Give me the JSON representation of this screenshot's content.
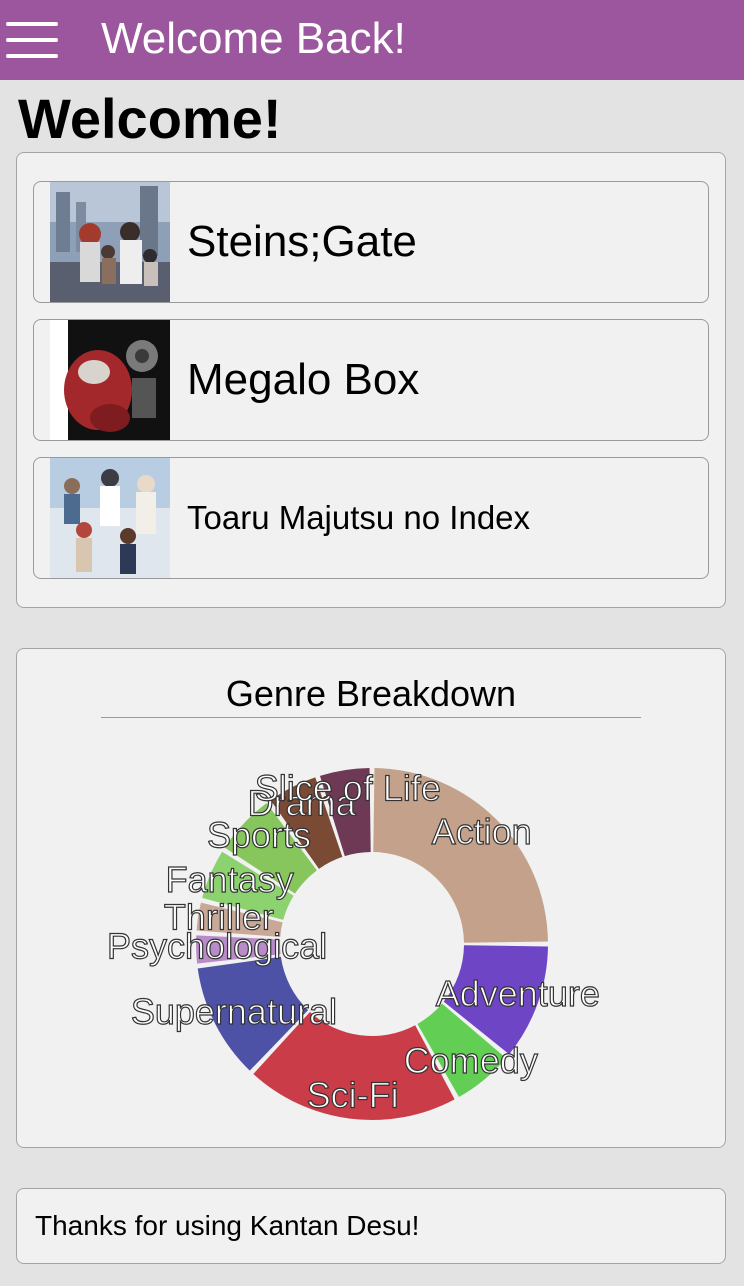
{
  "header": {
    "title": "Welcome Back!",
    "accent_color": "#9b569d",
    "menu_icon": "hamburger-menu-icon"
  },
  "page": {
    "heading": "Welcome!"
  },
  "recent": {
    "items": [
      {
        "title": "Steins;Gate"
      },
      {
        "title": "Megalo Box"
      },
      {
        "title": "Toaru Majutsu no Index"
      }
    ]
  },
  "genre": {
    "title": "Genre Breakdown"
  },
  "chart_data": {
    "type": "pie",
    "style": "donut",
    "title": "Genre Breakdown",
    "categories": [
      "Action",
      "Adventure",
      "Comedy",
      "Sci-Fi",
      "Supernatural",
      "Psychological",
      "Thriller",
      "Fantasy",
      "Sports",
      "Drama",
      "Slice of Life"
    ],
    "values": [
      25,
      11,
      6,
      20,
      11,
      3,
      3,
      5,
      6,
      5,
      5
    ],
    "colors": [
      "#c4a18a",
      "#6e45c4",
      "#62cf54",
      "#c93c48",
      "#4e52a6",
      "#b98bc9",
      "#c9a898",
      "#8cd26f",
      "#86c65c",
      "#7a4a35",
      "#6e3954"
    ]
  },
  "footer": {
    "text": "Thanks for using Kantan Desu!"
  }
}
